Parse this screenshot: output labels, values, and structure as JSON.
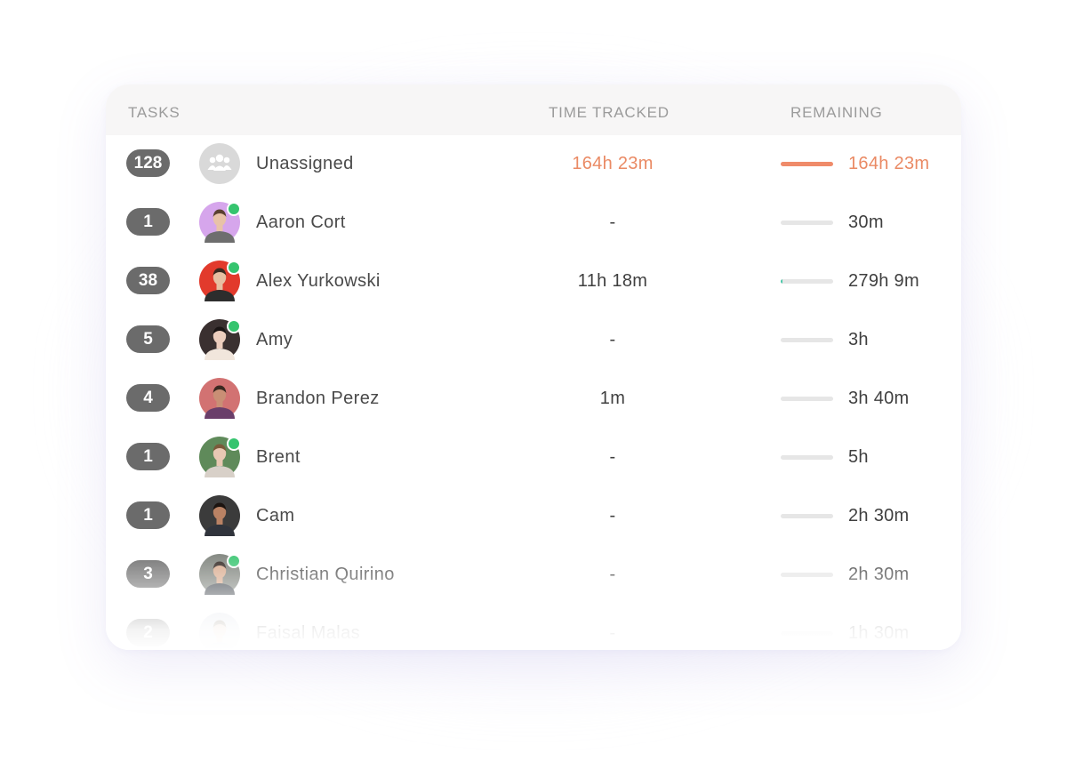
{
  "header": {
    "tasks": "TASKS",
    "time_tracked": "TIME TRACKED",
    "remaining": "REMAINING"
  },
  "colors": {
    "accent": "#ea8a64",
    "badge": "#6b6b6b",
    "online": "#35c46e",
    "bar_track": "#e6e6e6"
  },
  "rows": [
    {
      "tasks": "128",
      "name": "Unassigned",
      "avatar": "group-icon",
      "online": false,
      "time_tracked": "164h 23m",
      "remaining": "164h 23m",
      "progress": 1.0,
      "accent": true
    },
    {
      "tasks": "1",
      "name": "Aaron Cort",
      "avatar": "user-avatar",
      "online": true,
      "time_tracked": "-",
      "remaining": "30m",
      "progress": 0.0
    },
    {
      "tasks": "38",
      "name": "Alex Yurkowski",
      "avatar": "user-avatar",
      "online": true,
      "time_tracked": "11h 18m",
      "remaining": "279h 9m",
      "progress": 0.04
    },
    {
      "tasks": "5",
      "name": "Amy",
      "avatar": "user-avatar",
      "online": true,
      "time_tracked": "-",
      "remaining": "3h",
      "progress": 0.0
    },
    {
      "tasks": "4",
      "name": "Brandon Perez",
      "avatar": "user-avatar",
      "online": false,
      "time_tracked": "1m",
      "remaining": "3h 40m",
      "progress": 0.0
    },
    {
      "tasks": "1",
      "name": "Brent",
      "avatar": "user-avatar",
      "online": true,
      "time_tracked": "-",
      "remaining": "5h",
      "progress": 0.0
    },
    {
      "tasks": "1",
      "name": "Cam",
      "avatar": "user-avatar",
      "online": false,
      "time_tracked": "-",
      "remaining": "2h 30m",
      "progress": 0.0
    },
    {
      "tasks": "3",
      "name": "Christian Quirino",
      "avatar": "user-avatar",
      "online": true,
      "time_tracked": "-",
      "remaining": "2h 30m",
      "progress": 0.0
    },
    {
      "tasks": "2",
      "name": "Faisal Malas",
      "avatar": "user-avatar",
      "online": false,
      "time_tracked": "-",
      "remaining": "1h 30m",
      "progress": 0.0
    }
  ]
}
